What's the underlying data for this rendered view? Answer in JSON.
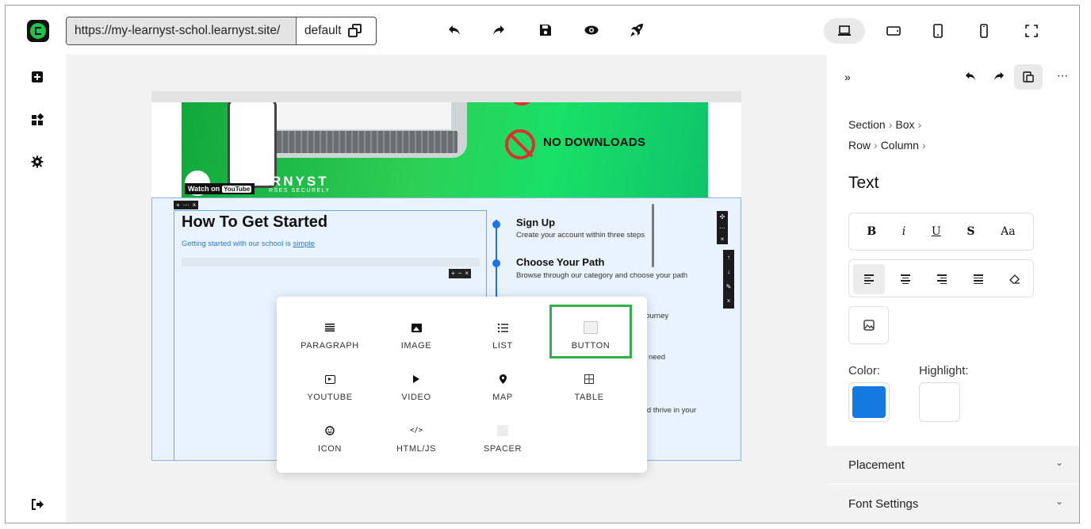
{
  "colors": {
    "brand": "#1fc24a",
    "accent": "#1a73e8",
    "selected_block": "#2fb24a",
    "text_color": "#1479e0",
    "highlight_color": "#ffffff"
  },
  "toolbar": {
    "url": "https://my-learnyst-schol.learnyst.site/",
    "version": "default",
    "icons": [
      "undo-icon",
      "redo-icon",
      "save-icon",
      "preview-icon",
      "publish-icon"
    ],
    "devices": [
      "desktop-icon",
      "tablet-landscape-icon",
      "tablet-portrait-icon",
      "mobile-icon",
      "fullscreen-icon"
    ]
  },
  "rail": {
    "icons": [
      "add-icon",
      "blocks-icon",
      "settings-icon",
      "logout-icon"
    ]
  },
  "banner": {
    "no_downloads": "NO DOWNLOADS",
    "brand": "LEARNYST",
    "brand_sub": "RSES SECURELY",
    "watch_on": "Watch on",
    "youtube": "YouTube"
  },
  "section": {
    "heading": "How To Get Started",
    "lead_text": "Getting started with our school is",
    "lead_link": "simple",
    "steps": [
      {
        "title": "Sign Up",
        "desc": "Create your account within three steps"
      },
      {
        "title": "Choose Your Path",
        "desc": "Browse through our category and choose your path"
      }
    ],
    "fragments": [
      "ur journey",
      "you need",
      ", and thrive in your"
    ]
  },
  "block_picker": {
    "items": [
      {
        "label": "PARAGRAPH",
        "icon": "paragraph-icon"
      },
      {
        "label": "IMAGE",
        "icon": "image-icon"
      },
      {
        "label": "LIST",
        "icon": "list-icon"
      },
      {
        "label": "BUTTON",
        "icon": "button-icon",
        "selected": true
      },
      {
        "label": "YOUTUBE",
        "icon": "youtube-icon"
      },
      {
        "label": "VIDEO",
        "icon": "video-icon"
      },
      {
        "label": "MAP",
        "icon": "map-pin-icon"
      },
      {
        "label": "TABLE",
        "icon": "table-icon"
      },
      {
        "label": "ICON",
        "icon": "smiley-icon"
      },
      {
        "label": "HTML/JS",
        "icon": "code-icon"
      },
      {
        "label": "SPACER",
        "icon": "spacer-icon"
      }
    ]
  },
  "panel": {
    "breadcrumb": [
      "Section",
      "Box",
      "Row",
      "Column"
    ],
    "title": "Text",
    "format_buttons": [
      "B",
      "i",
      "U",
      "S",
      "Aa"
    ],
    "color_label": "Color:",
    "highlight_label": "Highlight:",
    "accordions": [
      "Placement",
      "Font Settings"
    ]
  }
}
